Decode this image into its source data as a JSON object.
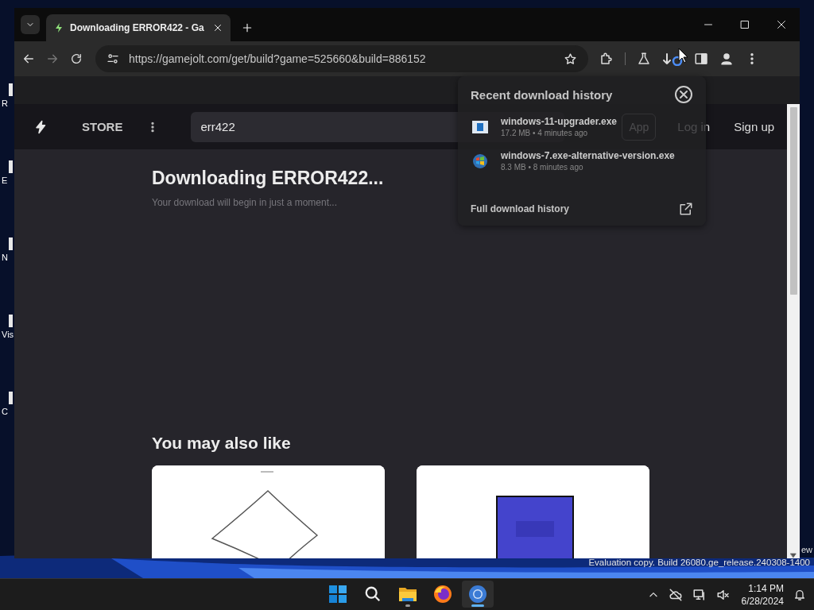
{
  "desktop_icons": [
    {
      "label": "R"
    },
    {
      "label": "E"
    },
    {
      "label": "N"
    },
    {
      "label": "Vis"
    },
    {
      "label": "C"
    }
  ],
  "browser": {
    "tabs": [
      {
        "title": "Downloading ERROR422 - Ga",
        "selected": true
      }
    ],
    "address": "https://gamejolt.com/get/build?game=525660&build=886152",
    "back_enabled": true,
    "forward_enabled": false,
    "page": {
      "nav": {
        "store": "STORE",
        "search_value": "err422",
        "app_button": "App",
        "login": "Log in",
        "signup": "Sign up"
      },
      "heading": "Downloading ERROR422...",
      "subtitle": "Your download will begin in just a moment...",
      "recommend_title": "You may also like"
    },
    "downloads_popup": {
      "title": "Recent download history",
      "items": [
        {
          "kind": "installer",
          "name": "windows-11-upgrader.exe",
          "meta": "17.2 MB • 4 minutes ago"
        },
        {
          "kind": "windows-logo",
          "name": "windows-7.exe-alternative-version.exe",
          "meta": "8.3 MB • 8 minutes ago"
        }
      ],
      "footer": "Full download history"
    }
  },
  "watermark": {
    "edge": "ew",
    "build": "Evaluation copy. Build 26080.ge_release.240308-1400"
  },
  "taskbar": {
    "apps": [
      {
        "kind": "start",
        "running": false,
        "selected": false
      },
      {
        "kind": "search",
        "running": false,
        "selected": false
      },
      {
        "kind": "explorer",
        "running": true,
        "selected": false
      },
      {
        "kind": "firefox",
        "running": false,
        "selected": false
      },
      {
        "kind": "chrome",
        "running": true,
        "selected": true
      }
    ],
    "time": "1:14 PM",
    "date": "6/28/2024"
  }
}
